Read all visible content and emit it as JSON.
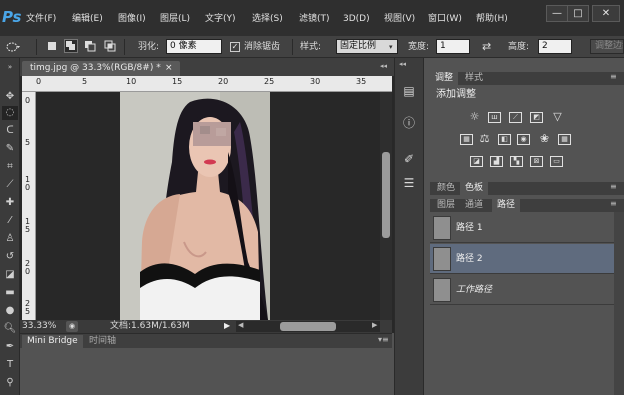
{
  "app": {
    "logo": "Ps",
    "menu": [
      "文件(F)",
      "编辑(E)",
      "图像(I)",
      "图层(L)",
      "文字(Y)",
      "选择(S)",
      "滤镜(T)",
      "3D(D)",
      "视图(V)",
      "窗口(W)",
      "帮助(H)"
    ],
    "window_buttons": [
      "—",
      "□",
      "✕"
    ]
  },
  "options": {
    "feather_label": "羽化:",
    "feather_value": "0 像素",
    "antialias_label": "消除锯齿",
    "style_label": "样式:",
    "style_value": "固定比例",
    "width_label": "宽度:",
    "width_value": "1",
    "height_label": "高度:",
    "height_value": "2",
    "refine_button": "调整边缘..."
  },
  "document": {
    "tab_title": "timg.jpg @ 33.3%(RGB/8#) *",
    "close_glyph": "×",
    "ruler_top": [
      "0",
      "5",
      "10",
      "15",
      "20",
      "25",
      "30",
      "35"
    ],
    "ruler_left": [
      "0",
      "5",
      "1 0",
      "1 5",
      "2 0",
      "2 5"
    ],
    "zoom": "33.33%",
    "doc_info": "文档:1.63M/1.63M"
  },
  "bottom_panel": {
    "tabs": [
      "Mini Bridge",
      "时间轴"
    ]
  },
  "right_panel": {
    "top_tabs": [
      "调整",
      "样式"
    ],
    "adjustments_title": "添加调整",
    "color_tabs": [
      "颜色",
      "色板"
    ],
    "layer_tabs": [
      "图层",
      "通道",
      "路径"
    ],
    "paths": [
      "路径 1",
      "路径 2",
      "工作路径"
    ]
  },
  "colors": {
    "accent": "#4aa6e8",
    "selected_row": "#5f6b7e"
  }
}
